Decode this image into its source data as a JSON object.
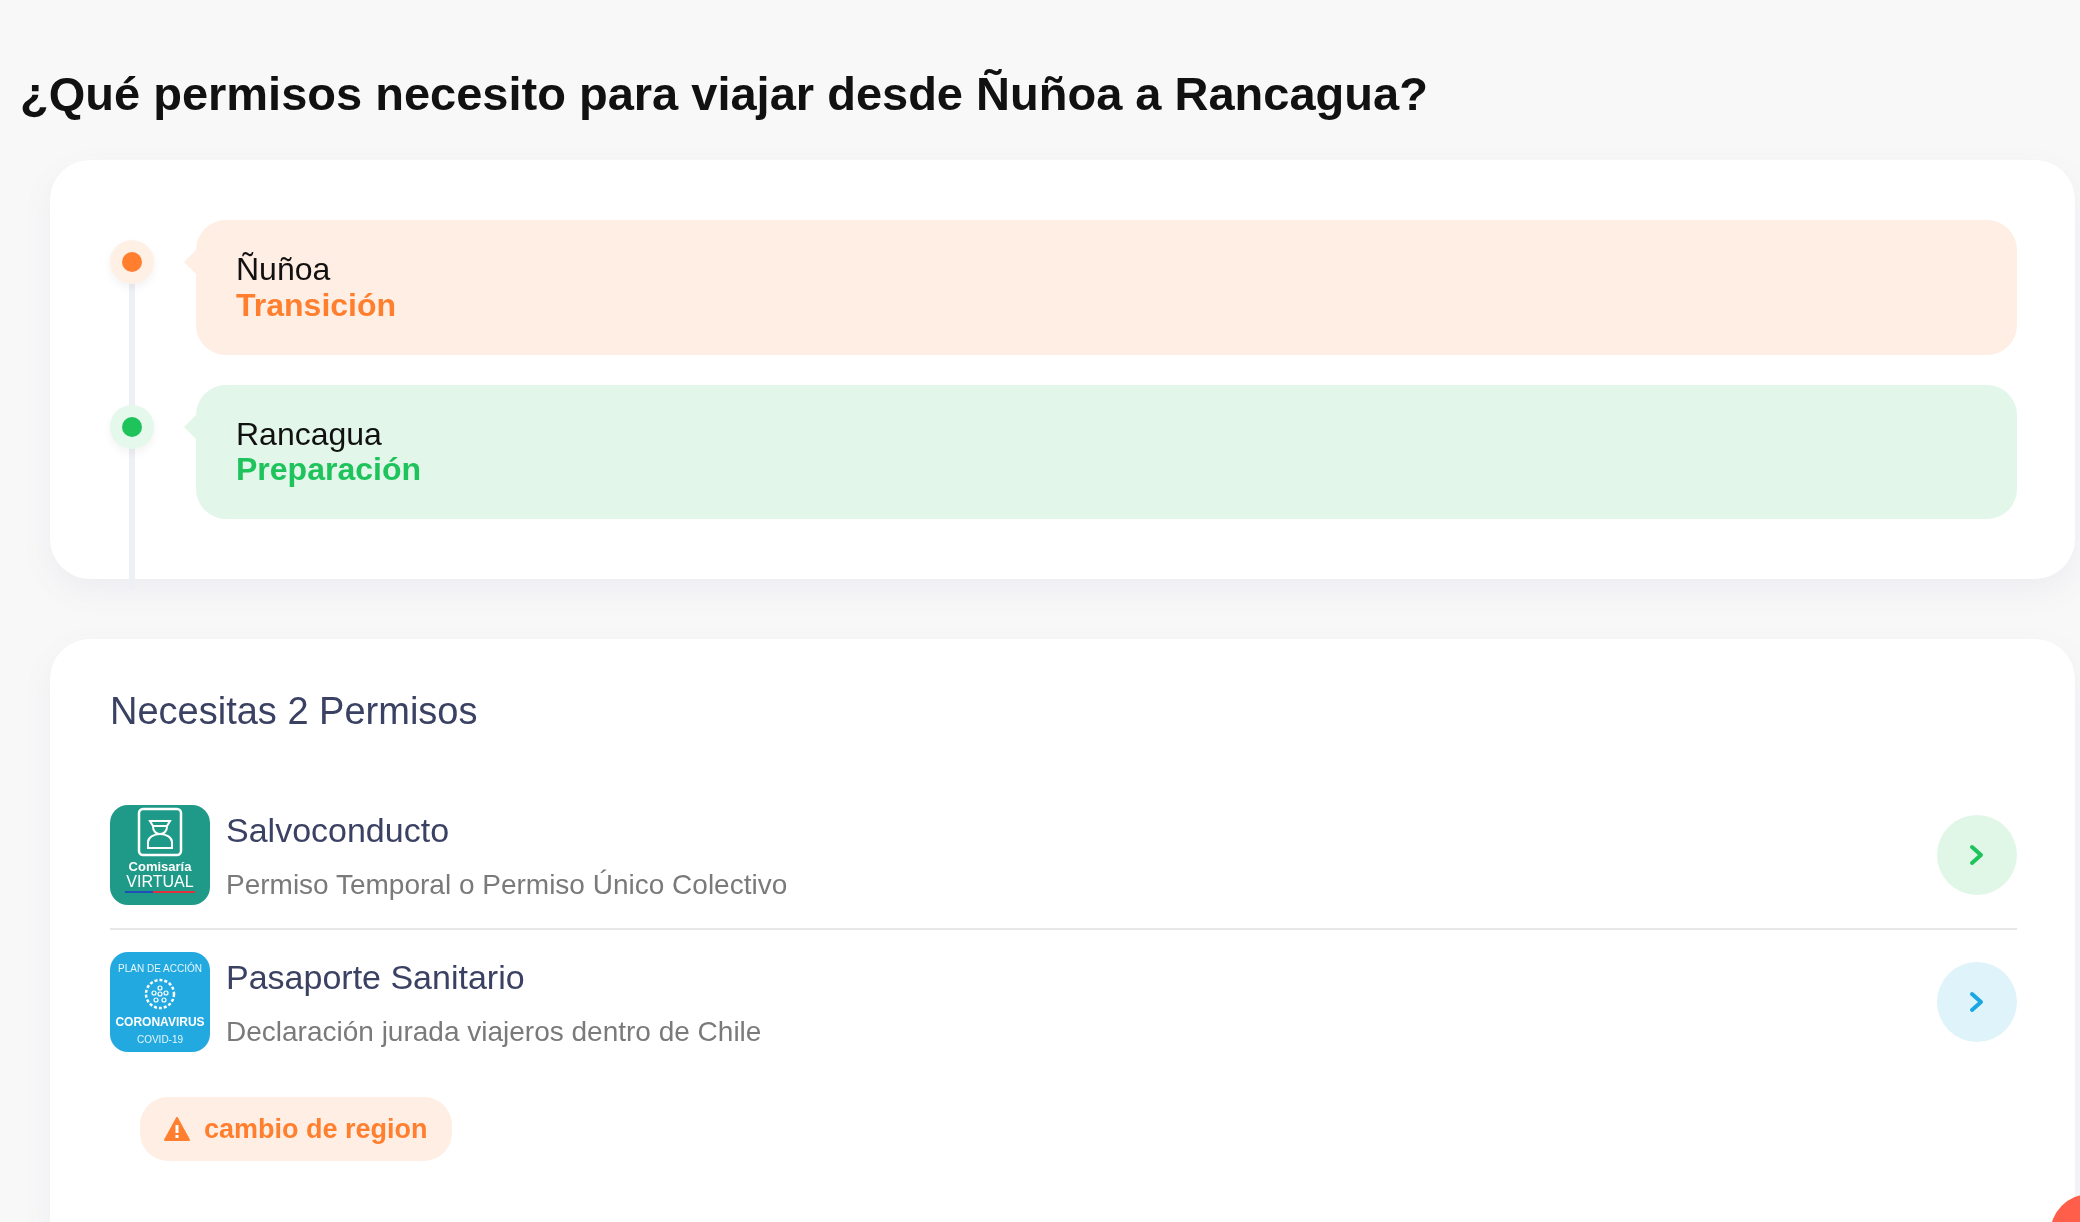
{
  "title": "¿Qué permisos necesito para viajar desde Ñuñoa a Rancagua?",
  "route": [
    {
      "place": "Ñuñoa",
      "phase": "Transición",
      "color": "#ff7f2f"
    },
    {
      "place": "Rancagua",
      "phase": "Preparación",
      "color": "#1fc35c"
    }
  ],
  "permits": {
    "heading": "Necesitas 2 Permisos",
    "items": [
      {
        "title": "Salvoconducto",
        "subtitle": "Permiso Temporal o Permiso Único Colectivo",
        "color": "#1fc35c",
        "logo": {
          "kind": "police",
          "lines": [
            "Comisaría",
            "VIRTUAL"
          ]
        }
      },
      {
        "title": "Pasaporte Sanitario",
        "subtitle": "Declaración jurada viajeros dentro de Chile",
        "color": "#1aa7e2",
        "logo": {
          "kind": "virus",
          "lines": [
            "PLAN DE ACCIÓN",
            "CORONAVIRUS",
            "COVID-19"
          ]
        }
      }
    ]
  },
  "notice": {
    "label": "cambio de region",
    "color": "#ff7f2f"
  }
}
